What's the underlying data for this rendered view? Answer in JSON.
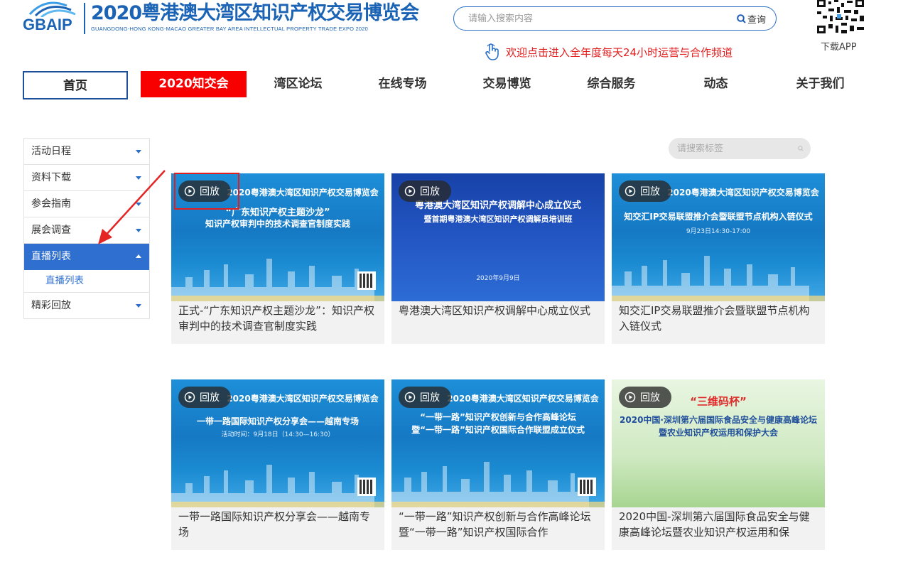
{
  "header": {
    "logo_mark": "GBAIP",
    "title": "2020粤港澳大湾区知识产权交易博览会",
    "subtitle": "GUANGDONG-HONG KONG-MACAO GREATER BAY AREA INTELLECTUAL PROPERTY TRADE EXPO 2020",
    "search": {
      "placeholder": "请输入搜索内容",
      "button_label": "查询"
    },
    "welcome": "欢迎点击进入全年度每天24小时运营与合作频道",
    "app_label": "下载APP"
  },
  "nav": {
    "items": [
      "首页",
      "2020知交会",
      "湾区论坛",
      "在线专场",
      "交易博览",
      "综合服务",
      "动态",
      "关于我们"
    ]
  },
  "sidebar": {
    "items": [
      "活动日程",
      "资料下载",
      "参会指南",
      "展会调查",
      "直播列表",
      "精彩回放"
    ],
    "active_sub": "直播列表"
  },
  "tag_search": {
    "placeholder": "请搜索标签"
  },
  "replay_label": "回放",
  "cards": [
    {
      "poster_title": "2020粤港澳大湾区知识产权交易博览会",
      "poster_line1": "“广东知识产权主题沙龙”",
      "poster_line2": "知识产权审判中的技术调查官制度实践",
      "caption": "正式-“广东知识产权主题沙龙”：知识产权审判中的技术调查官制度实践"
    },
    {
      "poster_title": "粤港澳大湾区知识产权调解中心成立仪式",
      "poster_line1": "暨首期粤港澳大湾区知识产权调解员培训班",
      "poster_line2": "2020年9月9日",
      "caption": "粤港澳大湾区知识产权调解中心成立仪式"
    },
    {
      "poster_title": "2020粤港澳大湾区知识产权交易博览会",
      "poster_line1": "知交汇IP交易联盟推介会暨联盟节点机构入链仪式",
      "poster_line2": "9月23日14:30-17:00",
      "caption": "知交汇IP交易联盟推介会暨联盟节点机构入链仪式"
    },
    {
      "poster_title": "2020粤港澳大湾区知识产权交易博览会",
      "poster_line1": "一带一路国际知识产权分享会——越南专场",
      "poster_line2": "活动时间：9月18日（14:30—16:30）",
      "caption": "一带一路国际知识产权分享会——越南专场"
    },
    {
      "poster_title": "2020粤港澳大湾区知识产权交易博览会",
      "poster_line1": "“一带一路”知识产权创新与合作高峰论坛",
      "poster_line2": "暨“一带一路”知识产权国际合作联盟成立仪式",
      "caption": "“一带一路”知识产权创新与合作高峰论坛暨“一带一路”知识产权国际合作"
    },
    {
      "poster_title": "“三维码杯”",
      "poster_line1": "2020中国·深圳第六届国际食品安全与健康高峰论坛",
      "poster_line2": "暨农业知识产权运用和保护大会",
      "caption": "2020中国-深圳第六届国际食品安全与健康高峰论坛暨农业知识产权运用和保"
    }
  ],
  "colors": {
    "brand_blue": "#1b63b5",
    "accent_red": "#f80000",
    "sidebar_active": "#2e6fd0"
  }
}
